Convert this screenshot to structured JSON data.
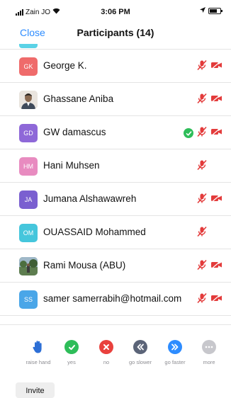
{
  "status_bar": {
    "carrier": "Zain JO",
    "time": "3:06 PM"
  },
  "header": {
    "close_label": "Close",
    "title": "Participants (14)"
  },
  "participants": [
    {
      "name": "George K.",
      "initials": "GK",
      "avatar_color": "#ef6b6b",
      "avatar_type": "initials",
      "video": true,
      "raised_badge": false
    },
    {
      "name": "Ghassane Aniba",
      "initials": "",
      "avatar_color": "#d9d4cf",
      "avatar_type": "photo-portrait",
      "video": true,
      "raised_badge": false
    },
    {
      "name": "GW damascus",
      "initials": "GD",
      "avatar_color": "#8e68d8",
      "avatar_type": "initials",
      "video": true,
      "raised_badge": true
    },
    {
      "name": "Hani Muhsen",
      "initials": "HM",
      "avatar_color": "#e88bc0",
      "avatar_type": "initials",
      "video": false,
      "raised_badge": false
    },
    {
      "name": "Jumana Alshawawreh",
      "initials": "JA",
      "avatar_color": "#7a5fd0",
      "avatar_type": "initials",
      "video": true,
      "raised_badge": false
    },
    {
      "name": "OUASSAID Mohammed",
      "initials": "OM",
      "avatar_color": "#45c6dc",
      "avatar_type": "initials",
      "video": false,
      "raised_badge": false
    },
    {
      "name": "Rami Mousa (ABU)",
      "initials": "",
      "avatar_color": "#6b8f6b",
      "avatar_type": "photo-landscape",
      "video": true,
      "raised_badge": false
    },
    {
      "name": "samer samerrabih@hotmail.com",
      "initials": "SS",
      "avatar_color": "#4aa6e8",
      "avatar_type": "initials",
      "video": true,
      "raised_badge": false
    }
  ],
  "reactions": [
    {
      "label": "raise hand",
      "icon": "hand-icon",
      "color": "#2d6fd6"
    },
    {
      "label": "yes",
      "icon": "check-icon",
      "color": "#2ebd59"
    },
    {
      "label": "no",
      "icon": "x-icon",
      "color": "#e9413d"
    },
    {
      "label": "go slower",
      "icon": "rewind-icon",
      "color": "#5b6478"
    },
    {
      "label": "go faster",
      "icon": "fast-forward-icon",
      "color": "#2d8cff"
    },
    {
      "label": "more",
      "icon": "ellipsis-icon",
      "color": "#c7c7cc"
    }
  ],
  "colors": {
    "accent": "#2d8cff",
    "muted_icon": "#e33b3b",
    "divider": "#e4e4e4"
  },
  "invite_label": "Invite"
}
